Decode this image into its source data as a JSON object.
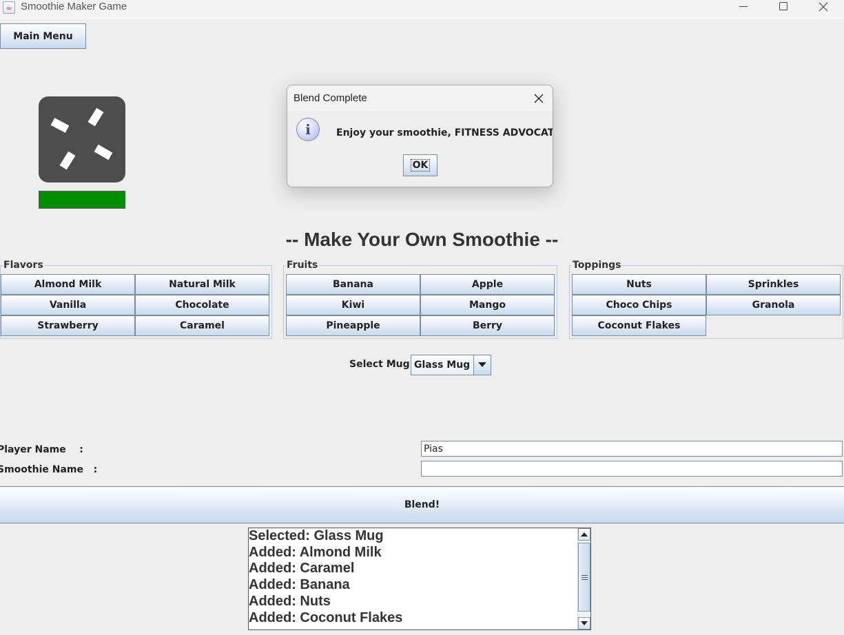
{
  "window": {
    "title": "Smoothie Maker Game"
  },
  "toolbar": {
    "main_menu_label": "Main Menu"
  },
  "blender": {
    "progress_fraction": 1.0,
    "progress_color": "#008f00"
  },
  "heading": "-- Make Your Own Smoothie --",
  "groups": {
    "flavors": {
      "title": "Flavors",
      "items": [
        "Almond Milk",
        "Natural Milk",
        "Vanilla",
        "Chocolate",
        "Strawberry",
        "Caramel"
      ]
    },
    "fruits": {
      "title": "Fruits",
      "items": [
        "Banana",
        "Apple",
        "Kiwi",
        "Mango",
        "Pineapple",
        "Berry"
      ]
    },
    "toppings": {
      "title": "Toppings",
      "items": [
        "Nuts",
        "Sprinkles",
        "Choco Chips",
        "Granola",
        "Coconut Flakes"
      ]
    }
  },
  "mug": {
    "label": "Select Mug:",
    "selected": "Glass Mug"
  },
  "form": {
    "player_name_label": "Player Name    :",
    "player_name_value": "Pias",
    "smoothie_name_label": "Smoothie Name   :",
    "smoothie_name_value": ""
  },
  "blend_button_label": "Blend!",
  "log": {
    "lines": [
      "Selected: Glass Mug",
      "Added: Almond Milk",
      "Added: Caramel",
      "Added: Banana",
      "Added: Nuts",
      "Added: Coconut Flakes"
    ]
  },
  "dialog": {
    "title": "Blend Complete",
    "message": "Enjoy your smoothie, FITNESS ADVOCATE!",
    "ok_label": "OK",
    "icon": "info-icon"
  }
}
